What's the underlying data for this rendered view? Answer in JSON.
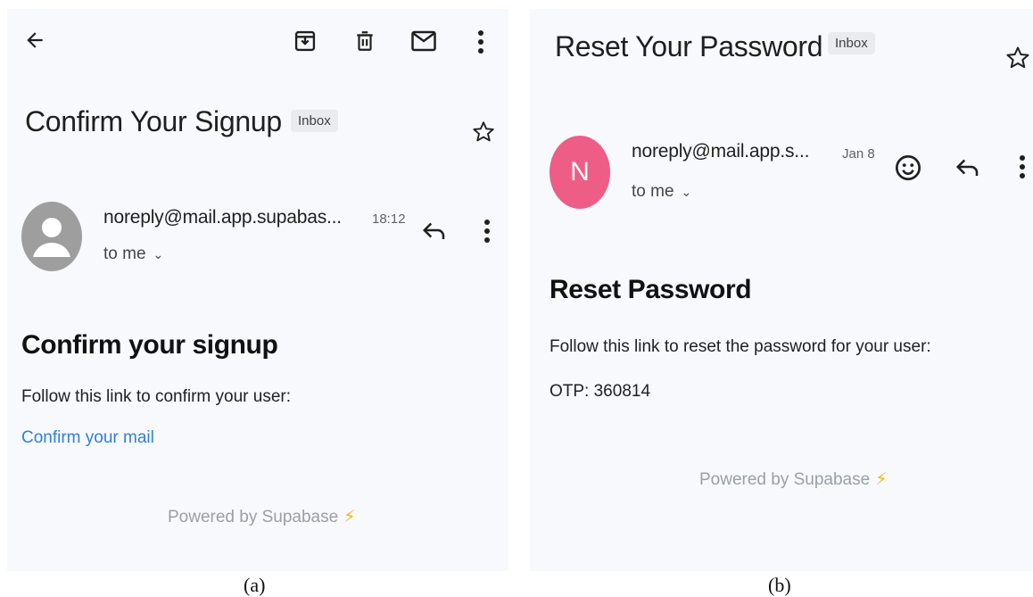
{
  "panel_a": {
    "subject": "Confirm Your Signup",
    "label_chip": "Inbox",
    "sender": "noreply@mail.app.supabas...",
    "time": "18:12",
    "recipient": "to me",
    "heading": "Confirm your signup",
    "body": "Follow this link to confirm your user:",
    "link": "Confirm your mail",
    "footer": "Powered by Supabase",
    "caption": "(a)",
    "icons": [
      "back-arrow-icon",
      "archive-icon",
      "trash-icon",
      "mail-icon",
      "more-vert-icon",
      "star-icon",
      "avatar-icon",
      "reply-icon",
      "lightning-icon"
    ]
  },
  "panel_b": {
    "subject": "Reset Your Password",
    "label_chip": "Inbox",
    "avatar_letter": "N",
    "sender": "noreply@mail.app.s...",
    "time": "Jan 8",
    "recipient": "to me",
    "heading": "Reset Password",
    "body": "Follow this link to reset the password for your user:",
    "otp": "OTP: 360814",
    "footer": "Powered by Supabase",
    "caption": "(b)",
    "icons": [
      "star-icon",
      "emoji-icon",
      "reply-icon",
      "more-vert-icon",
      "lightning-icon"
    ]
  },
  "colors": {
    "panel_bg": "#f7f9fd",
    "link": "#2f80d9",
    "avatar_gray": "#9e9e9e",
    "avatar_pink": "#ee5d86",
    "bolt": "#f5b400"
  }
}
